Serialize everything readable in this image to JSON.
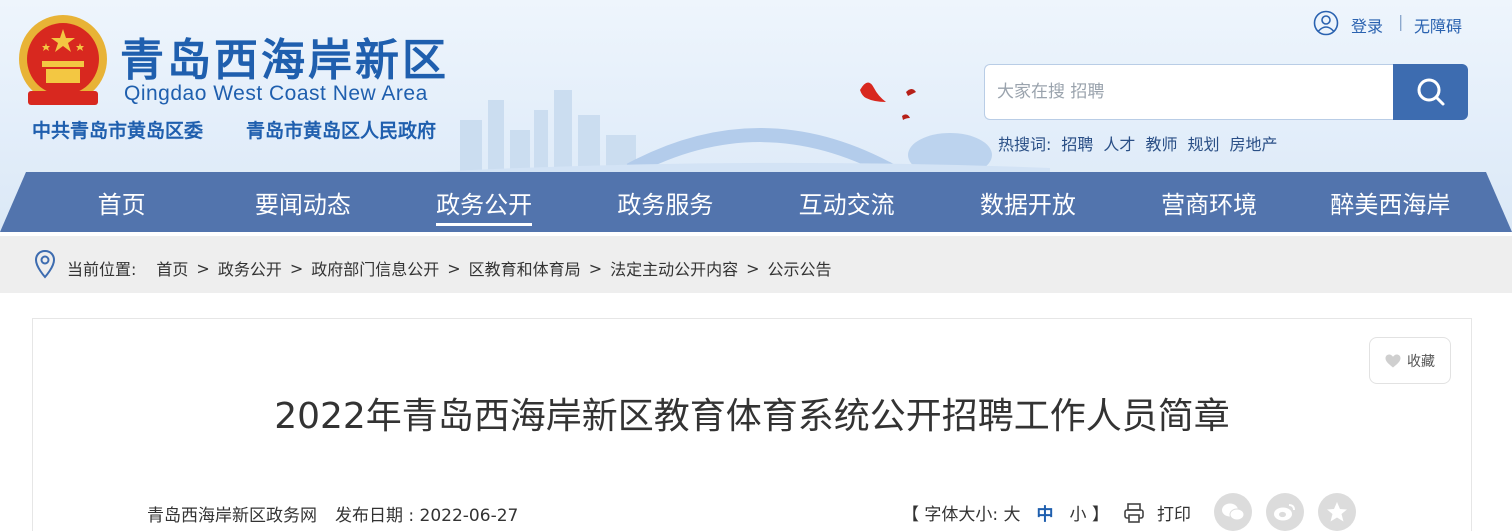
{
  "header": {
    "title_cn": "青岛西海岸新区",
    "title_en": "Qingdao West Coast New Area",
    "org_party": "中共青岛市黄岛区委",
    "org_gov": "青岛市黄岛区人民政府",
    "login": "登录",
    "separator": "|",
    "accessibility": "无障碍",
    "search_placeholder": "大家在搜 招聘",
    "hot_label": "热搜词:",
    "hot_words": [
      "招聘",
      "人才",
      "教师",
      "规划",
      "房地产"
    ]
  },
  "nav": {
    "items": [
      "首页",
      "要闻动态",
      "政务公开",
      "政务服务",
      "互动交流",
      "数据开放",
      "营商环境",
      "醉美西海岸"
    ],
    "active": "政务公开"
  },
  "breadcrumb": {
    "label": "当前位置:",
    "items": [
      "首页",
      "政务公开",
      "政府部门信息公开",
      "区教育和体育局",
      "法定主动公开内容",
      "公示公告"
    ],
    "separator": ">"
  },
  "article": {
    "favorite": "收藏",
    "title": "2022年青岛西海岸新区教育体育系统公开招聘工作人员简章",
    "source": "青岛西海岸新区政务网",
    "date_label": "发布日期 : 2022-06-27",
    "font_size_open": "【 字体大小: 大",
    "font_medium": "中",
    "font_small": "小 】",
    "print": "打印"
  },
  "colors": {
    "brand_blue": "#1f5fae",
    "nav_blue": "#5274ad",
    "search_button": "#3d6cb0"
  },
  "icons": [
    "emblem-icon",
    "user-icon",
    "search-icon",
    "location-pin-icon",
    "heart-icon",
    "printer-icon",
    "wechat-icon",
    "weibo-icon",
    "qzone-icon"
  ]
}
